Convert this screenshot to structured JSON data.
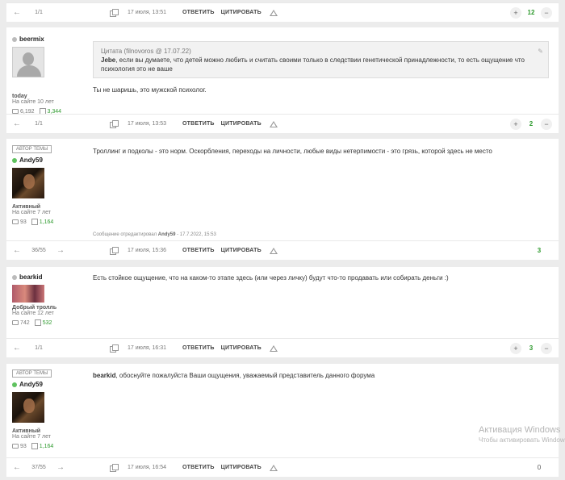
{
  "posts": [
    {
      "footer": {
        "page": "1/1",
        "date": "17 июля, 13:51",
        "reply": "ОТВЕТИТЬ",
        "quote": "ЦИТИРОВАТЬ",
        "score": "12"
      }
    },
    {
      "user": {
        "name": "beermix",
        "rank": "today",
        "since": "На сайте 10 лет",
        "posts": "6,192",
        "rep": "3,344"
      },
      "quote": {
        "header": "Цитата (filnovoros @ 17.07.22)",
        "author": "Jebe",
        "text": ", если вы думаете, что детей можно любить и считать своими только в следствии генетической принадлежности, то есть ощущение что психология это не ваше"
      },
      "text": "Ты не шаришь, это мужской психолог.",
      "footer": {
        "page": "1/1",
        "date": "17 июля, 13:53",
        "reply": "ОТВЕТИТЬ",
        "quote": "ЦИТИРОВАТЬ",
        "score": "2"
      }
    },
    {
      "user": {
        "tag": "АВТОР ТЕМЫ",
        "name": "Andy59",
        "rank": "Активный",
        "since": "На сайте 7 лет",
        "posts": "93",
        "rep": "1,164"
      },
      "text": "Троллинг и подколы - это норм. Оскорбления, переходы на личности, любые виды нетерпимости - это грязь, которой здесь не место",
      "edited": {
        "prefix": "Сообщение отредактировал",
        "who": "Andy59",
        "when": "- 17.7.2022, 15:53"
      },
      "footer": {
        "page": "36/55",
        "date": "17 июля, 15:36",
        "reply": "ОТВЕТИТЬ",
        "quote": "ЦИТИРОВАТЬ",
        "score": "3"
      }
    },
    {
      "user": {
        "name": "bearkid",
        "rank": "Добрый тролль",
        "since": "На сайте 12 лет",
        "posts": "742",
        "rep": "532"
      },
      "text": "Есть стойкое ощущение, что на каком-то этапе здесь (или через личку) будут что-то продавать или собирать деньги :)",
      "footer": {
        "page": "1/1",
        "date": "17 июля, 16:31",
        "reply": "ОТВЕТИТЬ",
        "quote": "ЦИТИРОВАТЬ",
        "score": "3"
      }
    },
    {
      "user": {
        "tag": "АВТОР ТЕМЫ",
        "name": "Andy59",
        "rank": "Активный",
        "since": "На сайте 7 лет",
        "posts": "93",
        "rep": "1,164"
      },
      "mention": "bearkid",
      "text": ", обоснуйте пожалуйста Ваши ощущения, уважаемый представитель данного форума",
      "footer": {
        "page": "37/55",
        "date": "17 июля, 16:54",
        "reply": "ОТВЕТИТЬ",
        "quote": "ЦИТИРОВАТЬ",
        "score": "0"
      }
    }
  ],
  "watermark": {
    "title": "Активация Windows",
    "sub": "Чтобы активировать Windows"
  }
}
